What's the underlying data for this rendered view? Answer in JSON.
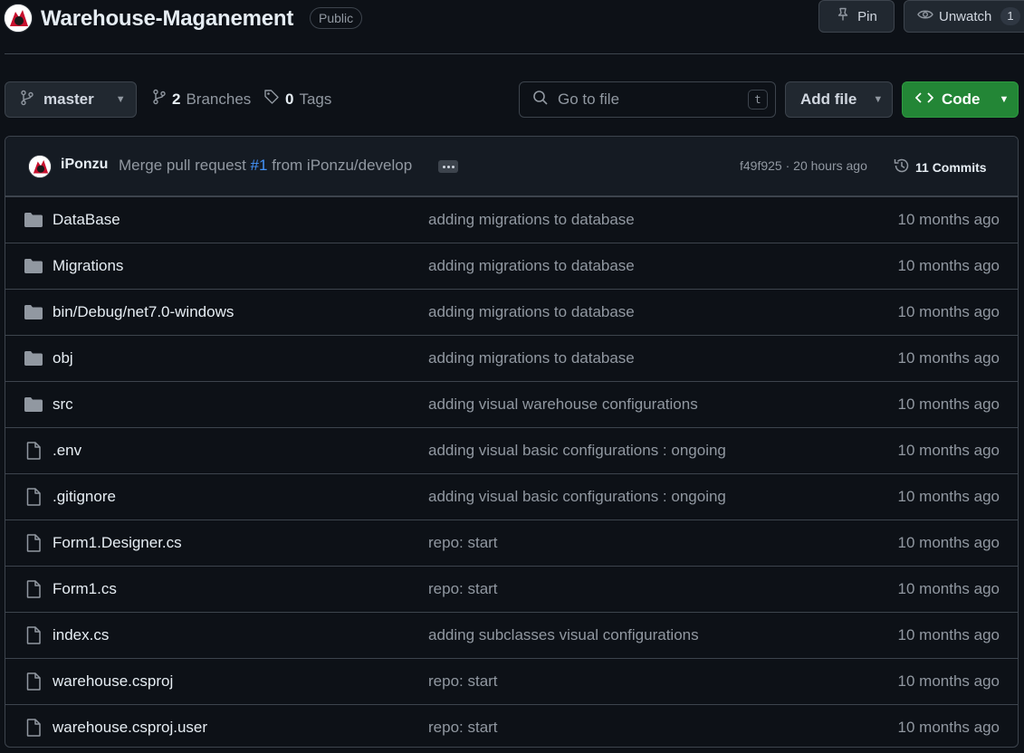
{
  "repo": {
    "name": "Warehouse-Maganement",
    "visibility": "Public",
    "pin_label": "Pin",
    "watch_label": "Unwatch",
    "watch_count": "1"
  },
  "toolbar": {
    "branch": "master",
    "branches_count": "2",
    "branches_label": "Branches",
    "tags_count": "0",
    "tags_label": "Tags",
    "search_placeholder": "Go to file",
    "search_shortcut": "t",
    "add_file_label": "Add file",
    "code_label": "Code"
  },
  "latest_commit": {
    "author": "iPonzu",
    "message_prefix": "Merge pull request",
    "pr_ref": "#1",
    "message_suffix": "from iPonzu/develop",
    "sha_time": "f49f925 · 20 hours ago",
    "commits_label": "11 Commits"
  },
  "files": [
    {
      "name": "DataBase",
      "type": "folder",
      "message": "adding migrations to database",
      "time": "10 months ago"
    },
    {
      "name": "Migrations",
      "type": "folder",
      "message": "adding migrations to database",
      "time": "10 months ago"
    },
    {
      "name": "bin/Debug/net7.0-windows",
      "type": "folder",
      "message": "adding migrations to database",
      "time": "10 months ago"
    },
    {
      "name": "obj",
      "type": "folder",
      "message": "adding migrations to database",
      "time": "10 months ago"
    },
    {
      "name": "src",
      "type": "folder",
      "message": "adding visual warehouse configurations",
      "time": "10 months ago"
    },
    {
      "name": ".env",
      "type": "file",
      "message": "adding visual basic configurations : ongoing",
      "time": "10 months ago"
    },
    {
      "name": ".gitignore",
      "type": "file",
      "message": "adding visual basic configurations : ongoing",
      "time": "10 months ago"
    },
    {
      "name": "Form1.Designer.cs",
      "type": "file",
      "message": "repo: start",
      "time": "10 months ago"
    },
    {
      "name": "Form1.cs",
      "type": "file",
      "message": "repo: start",
      "time": "10 months ago"
    },
    {
      "name": "index.cs",
      "type": "file",
      "message": "adding subclasses visual configurations",
      "time": "10 months ago"
    },
    {
      "name": "warehouse.csproj",
      "type": "file",
      "message": "repo: start",
      "time": "10 months ago"
    },
    {
      "name": "warehouse.csproj.user",
      "type": "file",
      "message": "repo: start",
      "time": "10 months ago"
    }
  ],
  "icons": {
    "folder": "folder-icon",
    "file": "file-icon"
  },
  "colors": {
    "background": "#0d1117",
    "primary_button": "#238636",
    "link": "#4493f8",
    "muted_text": "#9198a1"
  }
}
